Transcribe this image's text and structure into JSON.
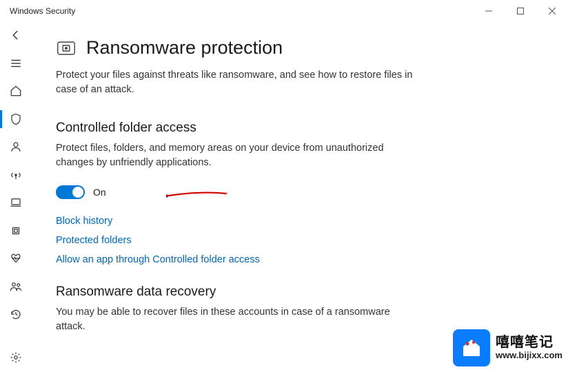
{
  "window": {
    "title": "Windows Security"
  },
  "sidebar": {
    "items": [
      {
        "name": "back",
        "icon": "arrow-left"
      },
      {
        "name": "menu",
        "icon": "hamburger"
      },
      {
        "name": "home",
        "icon": "home"
      },
      {
        "name": "virus",
        "icon": "shield",
        "active": true
      },
      {
        "name": "account",
        "icon": "person"
      },
      {
        "name": "firewall",
        "icon": "signal"
      },
      {
        "name": "app-browser",
        "icon": "laptop"
      },
      {
        "name": "device-security",
        "icon": "chip"
      },
      {
        "name": "performance",
        "icon": "heartbeat"
      },
      {
        "name": "family",
        "icon": "family"
      },
      {
        "name": "history",
        "icon": "history"
      }
    ],
    "settings": {
      "name": "settings",
      "icon": "gear"
    }
  },
  "page": {
    "title": "Ransomware protection",
    "description": "Protect your files against threats like ransomware, and see how to restore files in case of an attack."
  },
  "section_cfa": {
    "title": "Controlled folder access",
    "description": "Protect files, folders, and memory areas on your device from unauthorized changes by unfriendly applications.",
    "toggle_state": true,
    "toggle_label": "On",
    "links": {
      "block_history": "Block history",
      "protected_folders": "Protected folders",
      "allow_app": "Allow an app through Controlled folder access"
    }
  },
  "section_recovery": {
    "title": "Ransomware data recovery",
    "description": "You may be able to recover files in these accounts in case of a ransomware attack."
  },
  "watermark": {
    "name": "嘻嘻笔记",
    "url": "www.bijixx.com"
  }
}
